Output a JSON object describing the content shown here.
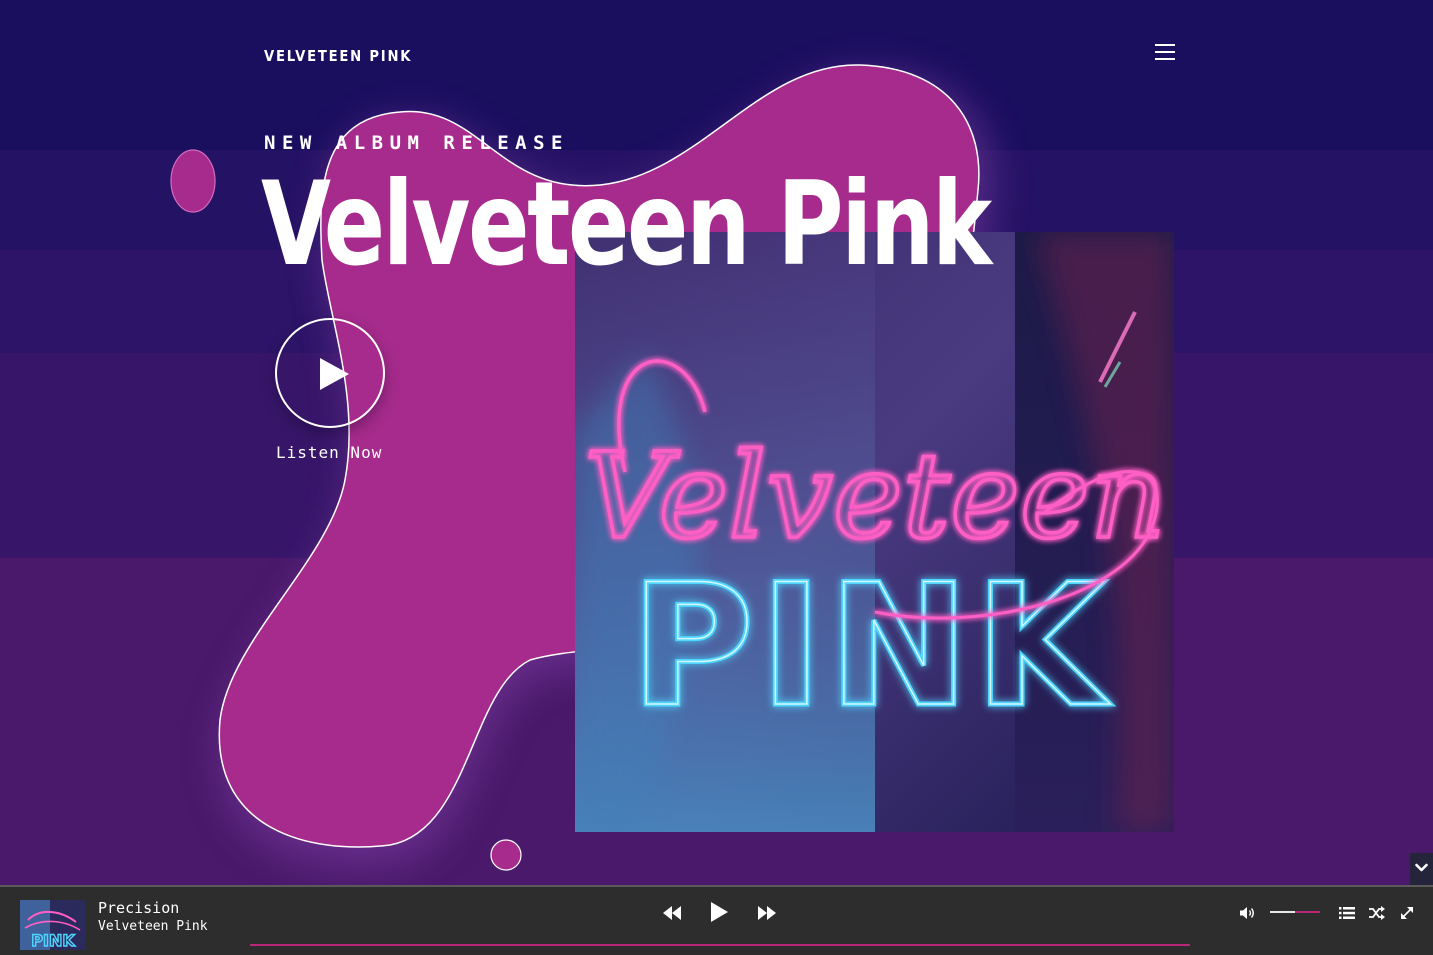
{
  "site": {
    "brand": "VELVETEEN PINK",
    "menu_icon": "hamburger-icon"
  },
  "hero": {
    "eyebrow": "NEW ALBUM RELEASE",
    "title": "Velveteen Pink",
    "cta_label": "Listen Now",
    "cover_script_text": "Velveteen",
    "cover_block_text": "PINK"
  },
  "player": {
    "track_title": "Precision",
    "track_artist": "Velveteen Pink",
    "volume_level": 0.5,
    "icons": [
      "rewind-icon",
      "play-icon",
      "fast-forward-icon",
      "volume-icon",
      "playlist-icon",
      "shuffle-icon",
      "expand-icon"
    ]
  },
  "colors": {
    "background_dark": "#1a0e5e",
    "background_light": "#4a196b",
    "blob": "#a62b8c",
    "accent_pink": "#b8267a",
    "neon_pink": "#ff5fc4",
    "neon_cyan": "#4fd6ff",
    "player_bg": "#2d2d2d"
  }
}
